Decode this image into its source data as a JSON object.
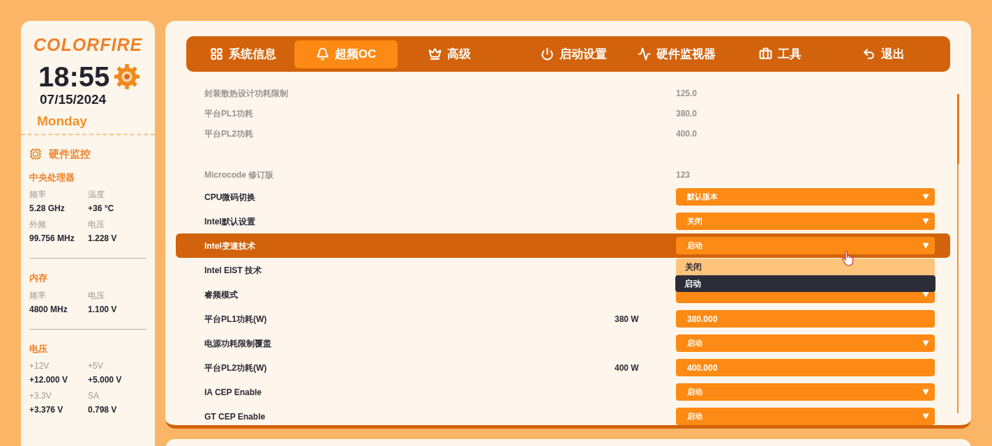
{
  "sidebar": {
    "logo": "COLORFIRE",
    "time": "18:55",
    "date": "07/15/2024",
    "weekday": "Monday",
    "section_title": "硬件监控",
    "groups": [
      {
        "title": "中央处理器",
        "items": [
          {
            "label": "频率",
            "value": "5.28 GHz"
          },
          {
            "label": "温度",
            "value": "+36 °C"
          },
          {
            "label": "外频",
            "value": "99.756 MHz"
          },
          {
            "label": "电压",
            "value": "1.228 V"
          }
        ]
      },
      {
        "title": "内存",
        "items": [
          {
            "label": "频率",
            "value": "4800 MHz"
          },
          {
            "label": "电压",
            "value": "1.100 V"
          }
        ]
      },
      {
        "title": "电压",
        "items": [
          {
            "label": "+12V",
            "value": "+12.000 V"
          },
          {
            "label": "+5V",
            "value": "+5.000 V"
          },
          {
            "label": "+3.3V",
            "value": "+3.376 V"
          },
          {
            "label": "SA",
            "value": "0.798 V"
          }
        ]
      }
    ]
  },
  "tabs": [
    {
      "label": "系统信息",
      "selected": false
    },
    {
      "label": "超频OC",
      "selected": true
    },
    {
      "label": "高级",
      "selected": false
    },
    {
      "label": "启动设置",
      "selected": false
    },
    {
      "label": "硬件监视器",
      "selected": false
    },
    {
      "label": "工具",
      "selected": false
    },
    {
      "label": "退出",
      "selected": false
    }
  ],
  "rows": [
    {
      "kind": "info",
      "label": "封装散热设计功耗限制",
      "value": "125.0"
    },
    {
      "kind": "info",
      "label": "平台PL1功耗",
      "value": "380.0"
    },
    {
      "kind": "info",
      "label": "平台PL2功耗",
      "value": "400.0"
    },
    {
      "kind": "spacer"
    },
    {
      "kind": "info",
      "label": "Microcode 修订版",
      "value": "123"
    },
    {
      "kind": "select",
      "label": "CPU微码切换",
      "value": "默认版本",
      "highlighted": false
    },
    {
      "kind": "select",
      "label": "Intel默认设置",
      "value": "关闭",
      "highlighted": false
    },
    {
      "kind": "select",
      "label": "Intel变速技术",
      "value": "启动",
      "highlighted": true,
      "options": [
        {
          "label": "关闭",
          "selected": false
        },
        {
          "label": "启动",
          "selected": true
        }
      ]
    },
    {
      "kind": "label",
      "label": "Intel EIST 技术",
      "highlighted": false
    },
    {
      "kind": "select",
      "label": "睿频模式",
      "highlighted": false
    },
    {
      "kind": "input",
      "label": "平台PL1功耗(W)",
      "reading": "380 W",
      "value": "380.000",
      "highlighted": false
    },
    {
      "kind": "select",
      "label": "电源功耗限制覆盖",
      "value": "启动",
      "highlighted": false
    },
    {
      "kind": "input",
      "label": "平台PL2功耗(W)",
      "reading": "400 W",
      "value": "400.000",
      "highlighted": false
    },
    {
      "kind": "select",
      "label": "IA CEP Enable",
      "value": "启动",
      "highlighted": false
    },
    {
      "kind": "select",
      "label": "GT CEP Enable",
      "value": "启动",
      "highlighted": false
    }
  ]
}
